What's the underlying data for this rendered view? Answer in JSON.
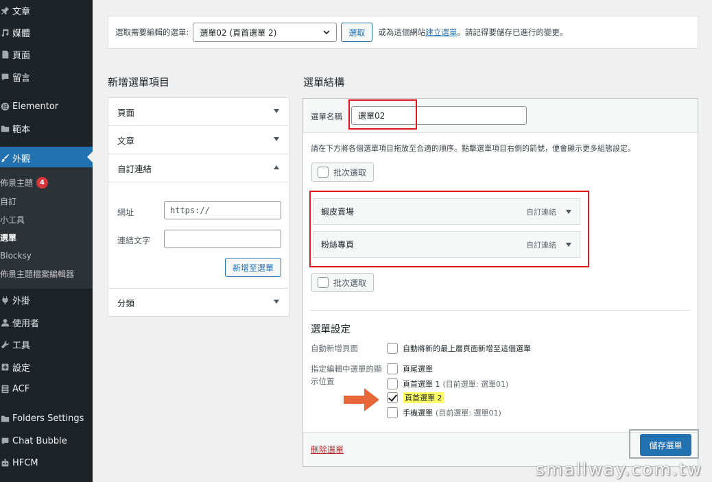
{
  "sidebar": {
    "items": [
      {
        "label": "文章",
        "icon": "pin-icon"
      },
      {
        "label": "媒體",
        "icon": "media-icon"
      },
      {
        "label": "頁面",
        "icon": "page-icon"
      },
      {
        "label": "留言",
        "icon": "comment-icon"
      },
      {
        "label": "Elementor",
        "icon": "elementor-icon"
      },
      {
        "label": "範本",
        "icon": "folder-icon"
      },
      {
        "label": "外觀",
        "icon": "brush-icon"
      },
      {
        "label": "外掛",
        "icon": "plug-icon"
      },
      {
        "label": "使用者",
        "icon": "user-icon"
      },
      {
        "label": "工具",
        "icon": "wrench-icon"
      },
      {
        "label": "設定",
        "icon": "settings-icon"
      },
      {
        "label": "ACF",
        "icon": "acf-icon"
      },
      {
        "label": "Folders Settings",
        "icon": "folder-settings-icon"
      },
      {
        "label": "Chat Bubble",
        "icon": "chat-icon"
      },
      {
        "label": "HFCM",
        "icon": "robot-icon"
      }
    ],
    "submenu": [
      {
        "label": "佈景主題",
        "badge": "4"
      },
      {
        "label": "自訂"
      },
      {
        "label": "小工具"
      },
      {
        "label": "選單"
      },
      {
        "label": "Blocksy"
      },
      {
        "label": "佈景主題檔案編輯器"
      }
    ]
  },
  "topbar": {
    "select_label": "選取需要編輯的選單:",
    "select_value": "選單02 (頁首選單 2)",
    "select_button": "選取",
    "or_text": "或為這個網站",
    "create_link": "建立選單",
    "remember_text": "。請記得要儲存已進行的變更。"
  },
  "left": {
    "heading": "新增選單項目",
    "panels": {
      "pages": "頁面",
      "posts": "文章",
      "custom_links": "自訂連結",
      "categories": "分類"
    },
    "url_label": "網址",
    "url_placeholder": "https://",
    "link_text_label": "連結文字",
    "add_button": "新增至選單"
  },
  "right": {
    "heading": "選單結構",
    "menu_name_label": "選單名稱",
    "menu_name_value": "選單02",
    "hint": "請在下方將各個選單項目拖放至合適的順序。點擊選單項目右側的箭號，便會顯示更多組態設定。",
    "bulk_select": "批次選取",
    "items": [
      {
        "title": "蝦皮賣場",
        "type": "自訂連結"
      },
      {
        "title": "粉絲專頁",
        "type": "自訂連結"
      }
    ],
    "settings": {
      "title": "選單設定",
      "auto_add_label": "自動新增頁面",
      "auto_add_option": "自動將新的最上層頁面新增至這個選單",
      "location_label_1": "指定編輯中選單的顯",
      "location_label_2": "示位置",
      "locations": [
        {
          "label": "頁尾選單",
          "sub": "",
          "checked": false
        },
        {
          "label": "頁首選單 1",
          "sub": "(目前選單: 選單01)",
          "checked": false
        },
        {
          "label": "頁首選單 2",
          "sub": "",
          "checked": true
        },
        {
          "label": "手機選單",
          "sub": "(目前選單: 選單01)",
          "checked": false
        }
      ]
    },
    "delete_link": "刪除選單",
    "save_button": "儲存選單"
  },
  "colors": {
    "accent": "#2271b1",
    "highlight_red": "#e3141b",
    "arrow_orange": "#e8673a",
    "highlight_yellow": "#ffff66"
  },
  "watermark": "smallway.com.tw"
}
